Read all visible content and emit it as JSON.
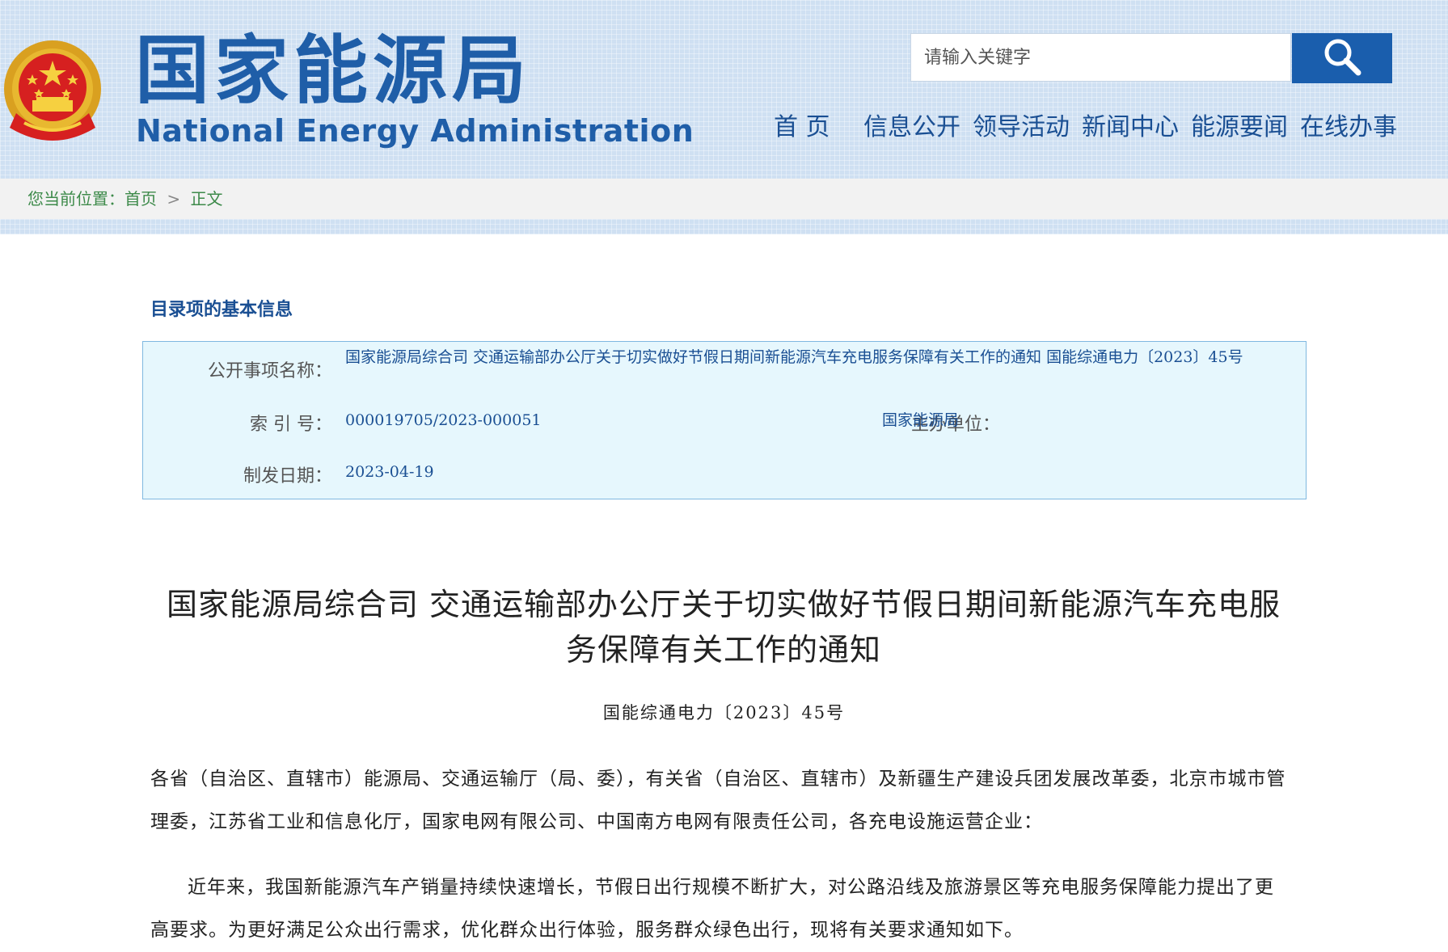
{
  "header": {
    "title_cn": "国家能源局",
    "title_en": "National Energy Administration",
    "emblem_icon": "national-emblem-icon"
  },
  "search": {
    "placeholder": "请输入关键字",
    "icon": "search-icon"
  },
  "nav": {
    "items": [
      "首 页",
      "信息公开",
      "领导活动",
      "新闻中心",
      "能源要闻",
      "在线办事"
    ]
  },
  "breadcrumb": {
    "prefix": "您当前位置：",
    "home": "首页",
    "separator": ">",
    "current": "正文"
  },
  "info": {
    "heading": "目录项的基本信息",
    "name_label": "公开事项名称：",
    "name_value": "国家能源局综合司  交通运输部办公厅关于切实做好节假日期间新能源汽车充电服务保障有关工作的通知  国能综通电力〔2023〕45号",
    "index_label": "索 引 号：",
    "index_value": "000019705/2023-000051",
    "org_label": "主办单位：",
    "org_value": "国家能源局",
    "date_label": "制发日期：",
    "date_value": "2023-04-19"
  },
  "article": {
    "title": "国家能源局综合司 交通运输部办公厅关于切实做好节假日期间新能源汽车充电服务保障有关工作的通知",
    "doc_number": "国能综通电力〔2023〕45号",
    "recipients": "各省（自治区、直辖市）能源局、交通运输厅（局、委），有关省（自治区、直辖市）及新疆生产建设兵团发展改革委，北京市城市管理委，江苏省工业和信息化厅，国家电网有限公司、中国南方电网有限责任公司，各充电设施运营企业：",
    "paragraph1": "近年来，我国新能源汽车产销量持续快速增长，节假日出行规模不断扩大，对公路沿线及旅游景区等充电服务保障能力提出了更高要求。为更好满足公众出行需求，优化群众出行体验，服务群众绿色出行，现将有关要求通知如下。"
  },
  "colors": {
    "brand_blue": "#1f5ea8",
    "search_button": "#1a5ead",
    "breadcrumb_green": "#3d8a4a",
    "info_bg": "#e6f7fd"
  }
}
